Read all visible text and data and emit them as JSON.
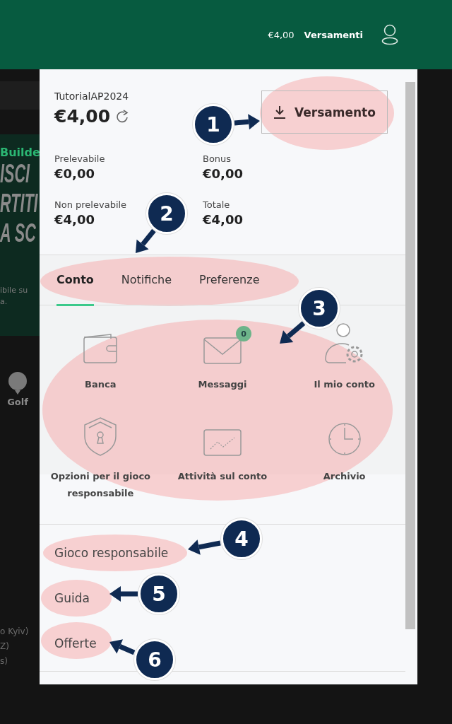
{
  "header": {
    "balance": "€4,00",
    "deposits_link": "Versamenti"
  },
  "background": {
    "promo_tag": "Builde",
    "headline": [
      "ISCI",
      "RTITI",
      "A SC"
    ],
    "note": [
      "ibile su",
      "a."
    ],
    "sport": "Golf",
    "list_fragments": [
      "o Kyiv)",
      "Z)",
      "s)"
    ]
  },
  "account": {
    "username": "TutorialAP2024",
    "balance": "€4,00",
    "deposit_button": "Versamento",
    "stats": [
      {
        "label": "Prelevabile",
        "value": "€0,00"
      },
      {
        "label": "Bonus",
        "value": "€0,00"
      },
      {
        "label": "Non prelevabile",
        "value": "€4,00"
      },
      {
        "label": "Totale",
        "value": "€4,00"
      }
    ]
  },
  "tabs": [
    {
      "label": "Conto",
      "selected": true
    },
    {
      "label": "Notifiche",
      "selected": false
    },
    {
      "label": "Preferenze",
      "selected": false
    }
  ],
  "shortcuts": [
    {
      "kind": "wallet",
      "label": "Banca"
    },
    {
      "kind": "mail",
      "label": "Messaggi",
      "badge": "0"
    },
    {
      "kind": "user-gear",
      "label": "Il mio conto"
    },
    {
      "kind": "shield",
      "label": "Opzioni per il gioco responsabile"
    },
    {
      "kind": "chart",
      "label": "Attività sul conto"
    },
    {
      "kind": "clock",
      "label": "Archivio"
    }
  ],
  "links": [
    "Gioco responsabile",
    "Guida",
    "Offerte"
  ],
  "annotations": [
    {
      "label": "1"
    },
    {
      "label": "2"
    },
    {
      "label": "3"
    },
    {
      "label": "4"
    },
    {
      "label": "5"
    },
    {
      "label": "6"
    }
  ]
}
